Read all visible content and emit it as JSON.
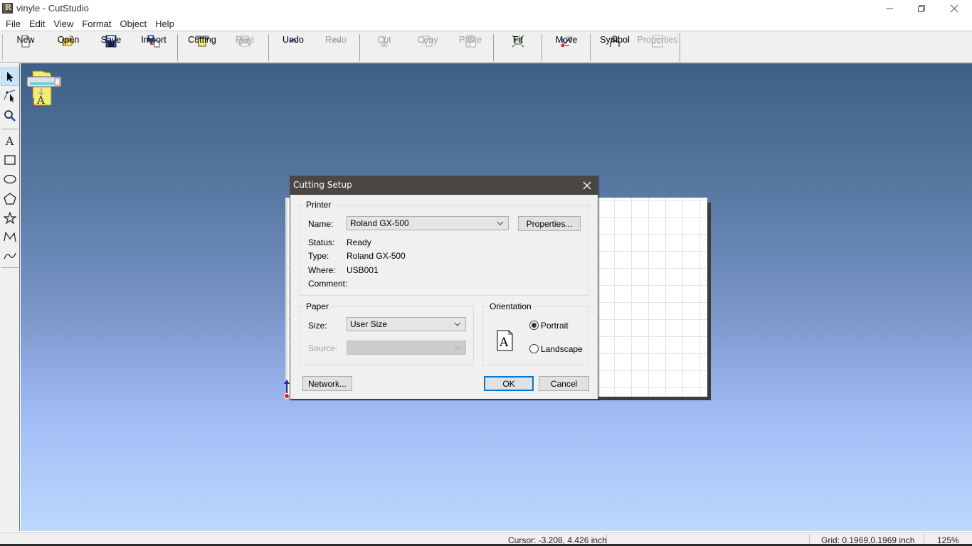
{
  "window": {
    "title": "vinyle - CutStudio",
    "controls": {
      "minimize": "minimize",
      "maximize": "restore",
      "close": "close"
    }
  },
  "menu": [
    "File",
    "Edit",
    "View",
    "Format",
    "Object",
    "Help"
  ],
  "toolbar": {
    "new": "New",
    "open": "Open",
    "save": "Save",
    "import": "Import",
    "cutting": "Cutting",
    "print": "Print",
    "undo": "Undo",
    "redo": "Redo",
    "cut": "Cut",
    "copy": "Copy",
    "paste": "Paste",
    "fit": "Fit",
    "move": "Move",
    "symbol": "Symbol",
    "properties": "Properties"
  },
  "toolbar_disabled": [
    "Print",
    "Redo",
    "Cut",
    "Copy",
    "Paste",
    "Properties"
  ],
  "palette": {
    "tools": [
      "select-tool",
      "edit-points-tool",
      "zoom-tool",
      "text-tool",
      "rectangle-tool",
      "ellipse-tool",
      "polygon-tool",
      "star-tool",
      "polyline-tool",
      "curve-tool"
    ],
    "active": "select-tool"
  },
  "dialog": {
    "title": "Cutting Setup",
    "printer": {
      "group_label": "Printer",
      "name_label": "Name:",
      "name_value": "Roland GX-500",
      "properties_button": "Properties...",
      "status_label": "Status:",
      "status_value": "Ready",
      "type_label": "Type:",
      "type_value": "Roland GX-500",
      "where_label": "Where:",
      "where_value": "USB001",
      "comment_label": "Comment:",
      "comment_value": ""
    },
    "paper": {
      "group_label": "Paper",
      "size_label": "Size:",
      "size_value": "User Size",
      "source_label": "Source:",
      "source_value": ""
    },
    "orientation": {
      "group_label": "Orientation",
      "portrait_label": "Portrait",
      "landscape_label": "Landscape",
      "selected": "Portrait",
      "preview_glyph": "A"
    },
    "buttons": {
      "network": "Network...",
      "ok": "OK",
      "cancel": "Cancel"
    }
  },
  "statusbar": {
    "cursor": "Cursor: -3.208, 4.426 inch",
    "grid": "Grid: 0.1969,0.1969 inch",
    "zoom": "125%"
  },
  "colors": {
    "dialog_title_bg": "#4a4644",
    "default_button_border": "#0078d7",
    "canvas_top": "#3f5f86",
    "canvas_bottom": "#bcd8fd",
    "palette_active": "#cce4f7"
  }
}
